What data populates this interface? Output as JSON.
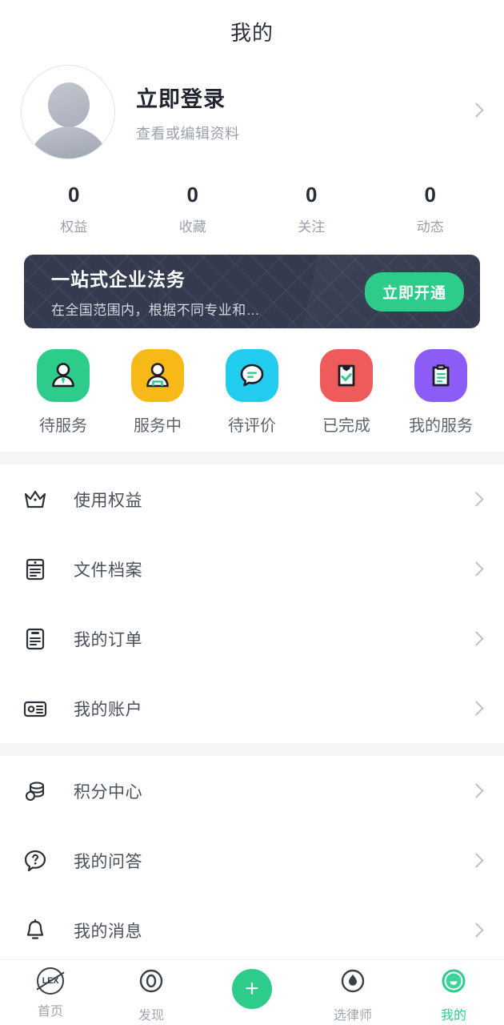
{
  "header": {
    "title": "我的"
  },
  "profile": {
    "name": "立即登录",
    "subtitle": "查看或编辑资料",
    "avatar_icon": "default-avatar-icon",
    "chevron_icon": "chevron-right-icon"
  },
  "stats": [
    {
      "value": "0",
      "label": "权益"
    },
    {
      "value": "0",
      "label": "收藏"
    },
    {
      "value": "0",
      "label": "关注"
    },
    {
      "value": "0",
      "label": "动态"
    }
  ],
  "banner": {
    "title": "一站式企业法务",
    "subtitle": "在全国范围内，根据不同专业和…",
    "button_label": "立即开通",
    "bg_color": "#343b4e",
    "button_color": "#2ecc8b"
  },
  "services": [
    {
      "label": "待服务",
      "icon": "person-tie-icon",
      "color": "#2ecc8b"
    },
    {
      "label": "服务中",
      "icon": "person-working-icon",
      "color": "#f6b917"
    },
    {
      "label": "待评价",
      "icon": "chat-bubble-icon",
      "color": "#22ccee"
    },
    {
      "label": "已完成",
      "icon": "clipboard-check-icon",
      "color": "#ef5a5a"
    },
    {
      "label": "我的服务",
      "icon": "clipboard-list-icon",
      "color": "#8b5cf6"
    }
  ],
  "menu_groups": [
    {
      "items": [
        {
          "label": "使用权益",
          "icon": "crown-icon"
        },
        {
          "label": "文件档案",
          "icon": "document-icon"
        },
        {
          "label": "我的订单",
          "icon": "order-list-icon"
        },
        {
          "label": "我的账户",
          "icon": "card-icon"
        }
      ]
    },
    {
      "items": [
        {
          "label": "积分中心",
          "icon": "coins-icon"
        },
        {
          "label": "我的问答",
          "icon": "question-bubble-icon"
        },
        {
          "label": "我的消息",
          "icon": "bell-icon"
        }
      ]
    }
  ],
  "tabbar": {
    "active": "我的",
    "accent_color": "#2ecc8b",
    "items": [
      {
        "label": "首页",
        "icon": "lex-logo-icon",
        "active": false
      },
      {
        "label": "发现",
        "icon": "discover-ring-icon",
        "active": false
      },
      {
        "label": "",
        "icon": "plus-fab-icon",
        "active": false
      },
      {
        "label": "选律师",
        "icon": "droplet-icon",
        "active": false
      },
      {
        "label": "我的",
        "icon": "smile-face-icon",
        "active": true
      }
    ]
  }
}
